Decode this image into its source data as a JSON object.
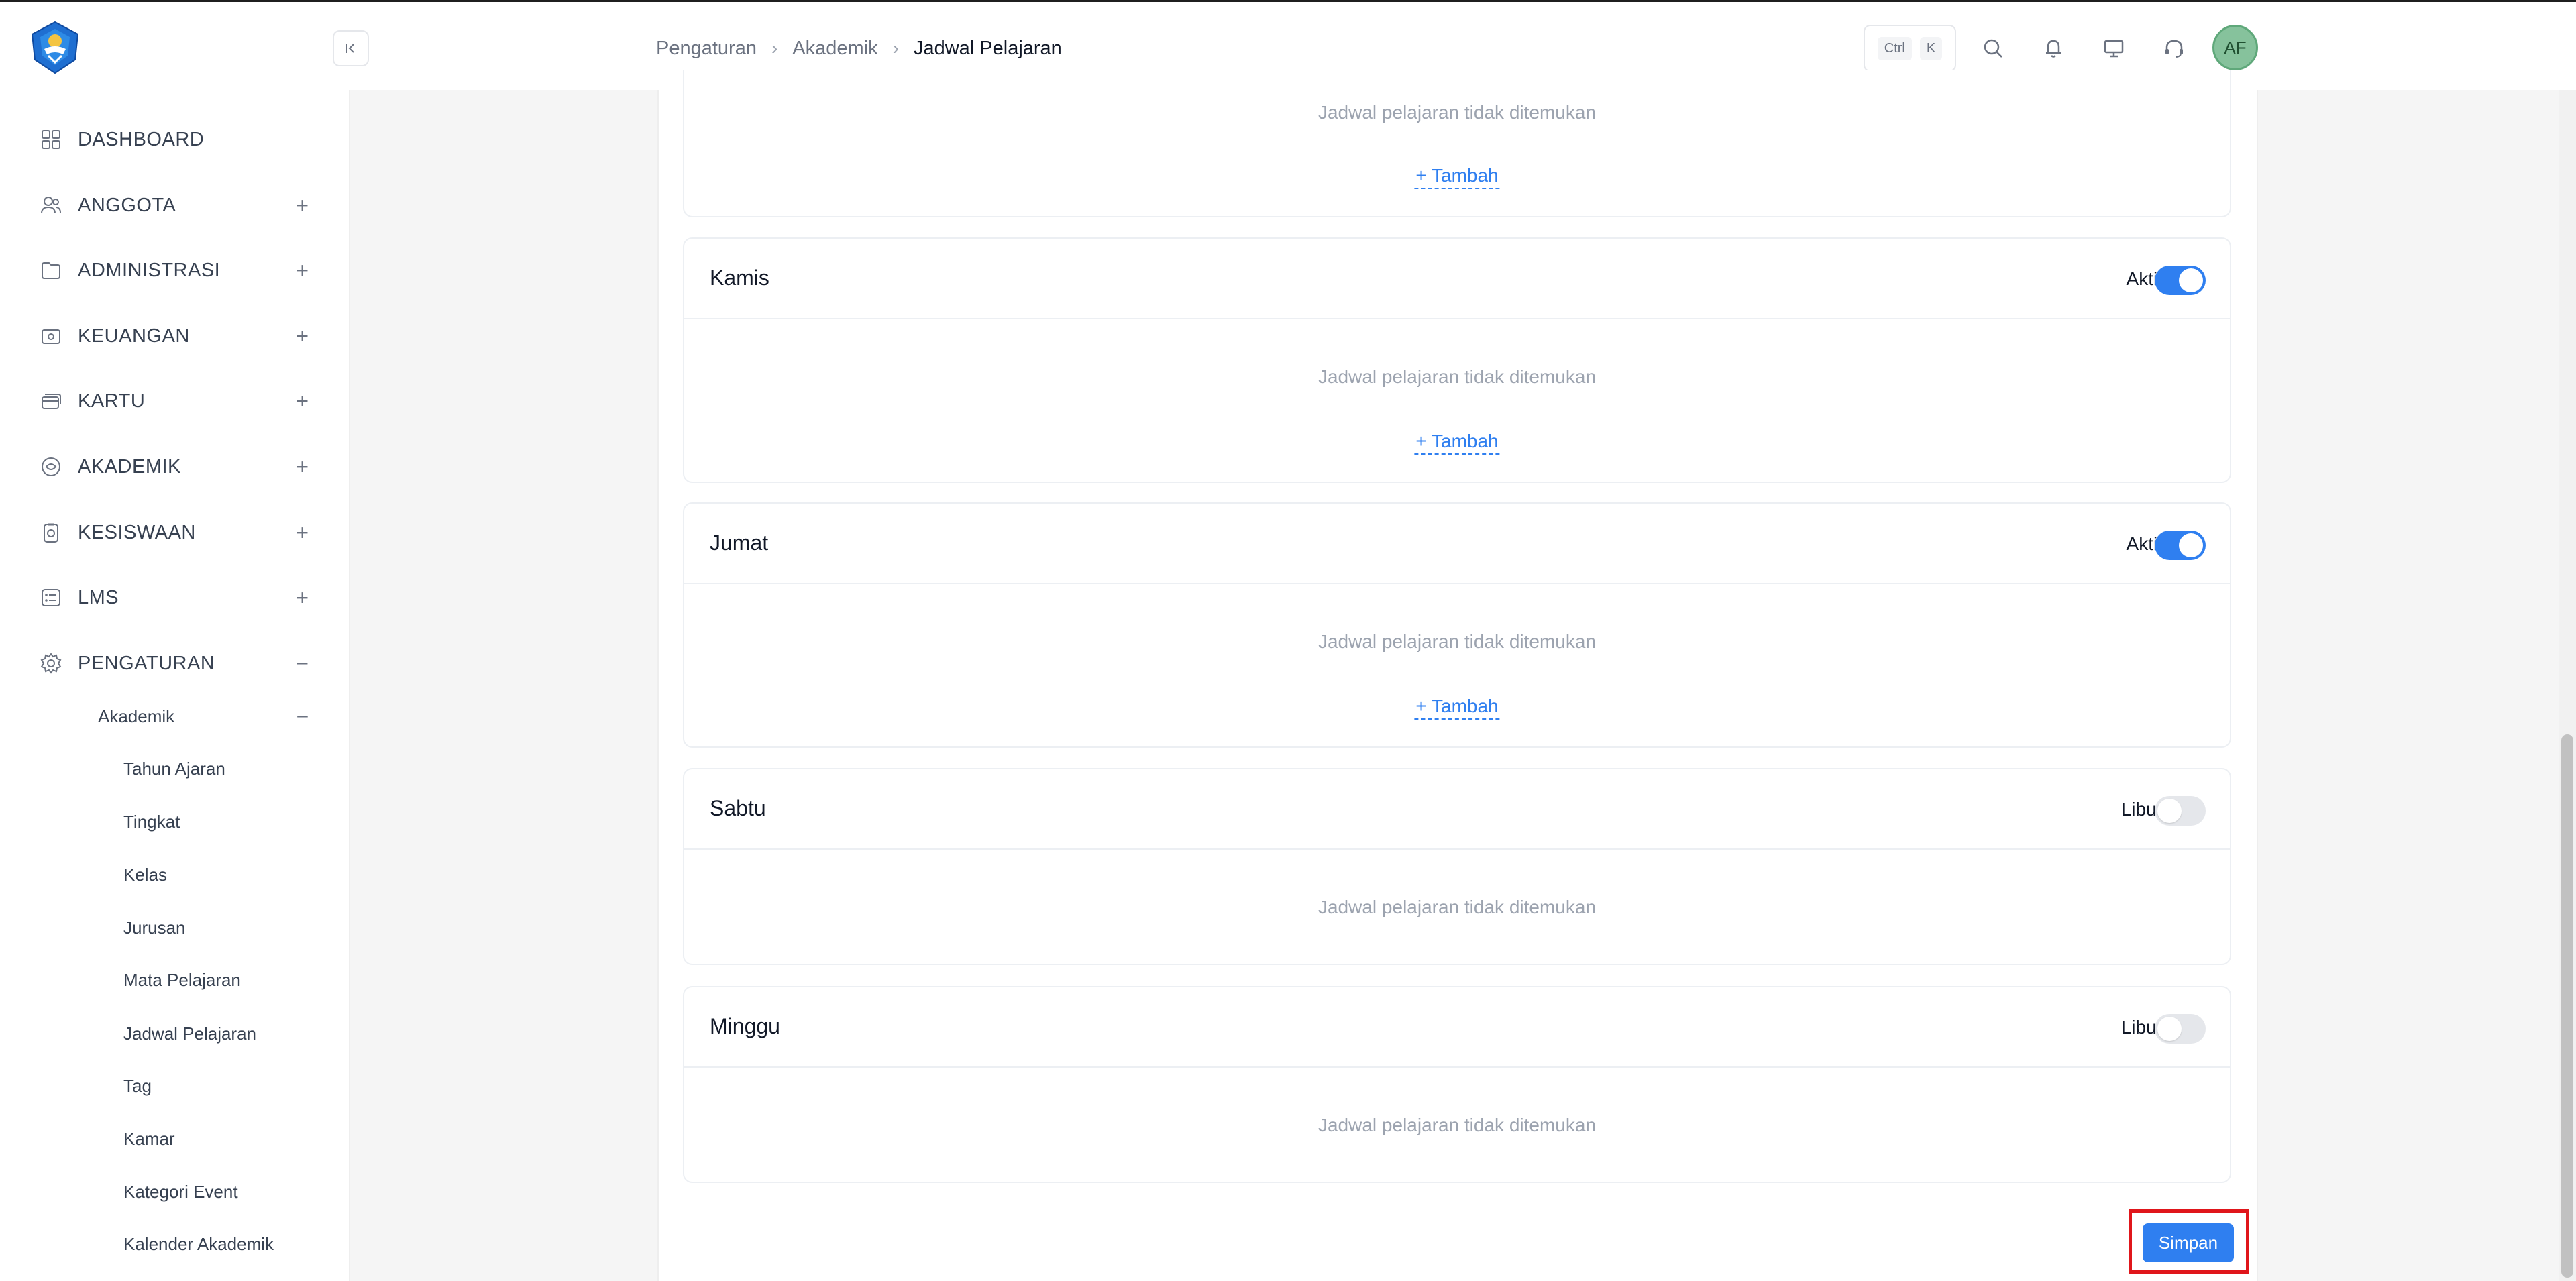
{
  "header": {
    "logo": "tut-wuri-handayani-logo",
    "breadcrumb": [
      "Pengaturan",
      "Akademik",
      "Jadwal Pelajaran"
    ],
    "shortcut": {
      "key1": "Ctrl",
      "key2": "K"
    },
    "avatar_initials": "AF"
  },
  "sidebar": {
    "items": [
      {
        "label": "DASHBOARD",
        "icon": "grid-icon",
        "expander": ""
      },
      {
        "label": "ANGGOTA",
        "icon": "users-icon",
        "expander": "+"
      },
      {
        "label": "ADMINISTRASI",
        "icon": "folder-icon",
        "expander": "+"
      },
      {
        "label": "KEUANGAN",
        "icon": "wallet-icon",
        "expander": "+"
      },
      {
        "label": "KARTU",
        "icon": "cards-icon",
        "expander": "+"
      },
      {
        "label": "AKADEMIK",
        "icon": "academic-icon",
        "expander": "+"
      },
      {
        "label": "KESISWAAN",
        "icon": "badge-icon",
        "expander": "+"
      },
      {
        "label": "LMS",
        "icon": "list-icon",
        "expander": "+"
      },
      {
        "label": "PENGATURAN",
        "icon": "gear-icon",
        "expander": "−"
      }
    ],
    "sub": {
      "label": "Akademik",
      "expander": "−"
    },
    "subsub": [
      "Tahun Ajaran",
      "Tingkat",
      "Kelas",
      "Jurusan",
      "Mata Pelajaran",
      "Jadwal Pelajaran",
      "Tag",
      "Kamar",
      "Kategori Event",
      "Kalender Akademik"
    ]
  },
  "main": {
    "partial_card": {
      "empty": "Jadwal pelajaran tidak ditemukan",
      "add": "+ Tambah"
    },
    "days": [
      {
        "name": "Kamis",
        "status": "Aktif",
        "on": true,
        "empty": "Jadwal pelajaran tidak ditemukan",
        "add": "+ Tambah"
      },
      {
        "name": "Jumat",
        "status": "Aktif",
        "on": true,
        "empty": "Jadwal pelajaran tidak ditemukan",
        "add": "+ Tambah"
      },
      {
        "name": "Sabtu",
        "status": "Libur",
        "on": false,
        "empty": "Jadwal pelajaran tidak ditemukan"
      },
      {
        "name": "Minggu",
        "status": "Libur",
        "on": false,
        "empty": "Jadwal pelajaran tidak ditemukan"
      }
    ],
    "save_label": "Simpan"
  },
  "colors": {
    "accent": "#2f7ff0",
    "highlight": "#e0161b",
    "avatar": "#86c29c"
  }
}
